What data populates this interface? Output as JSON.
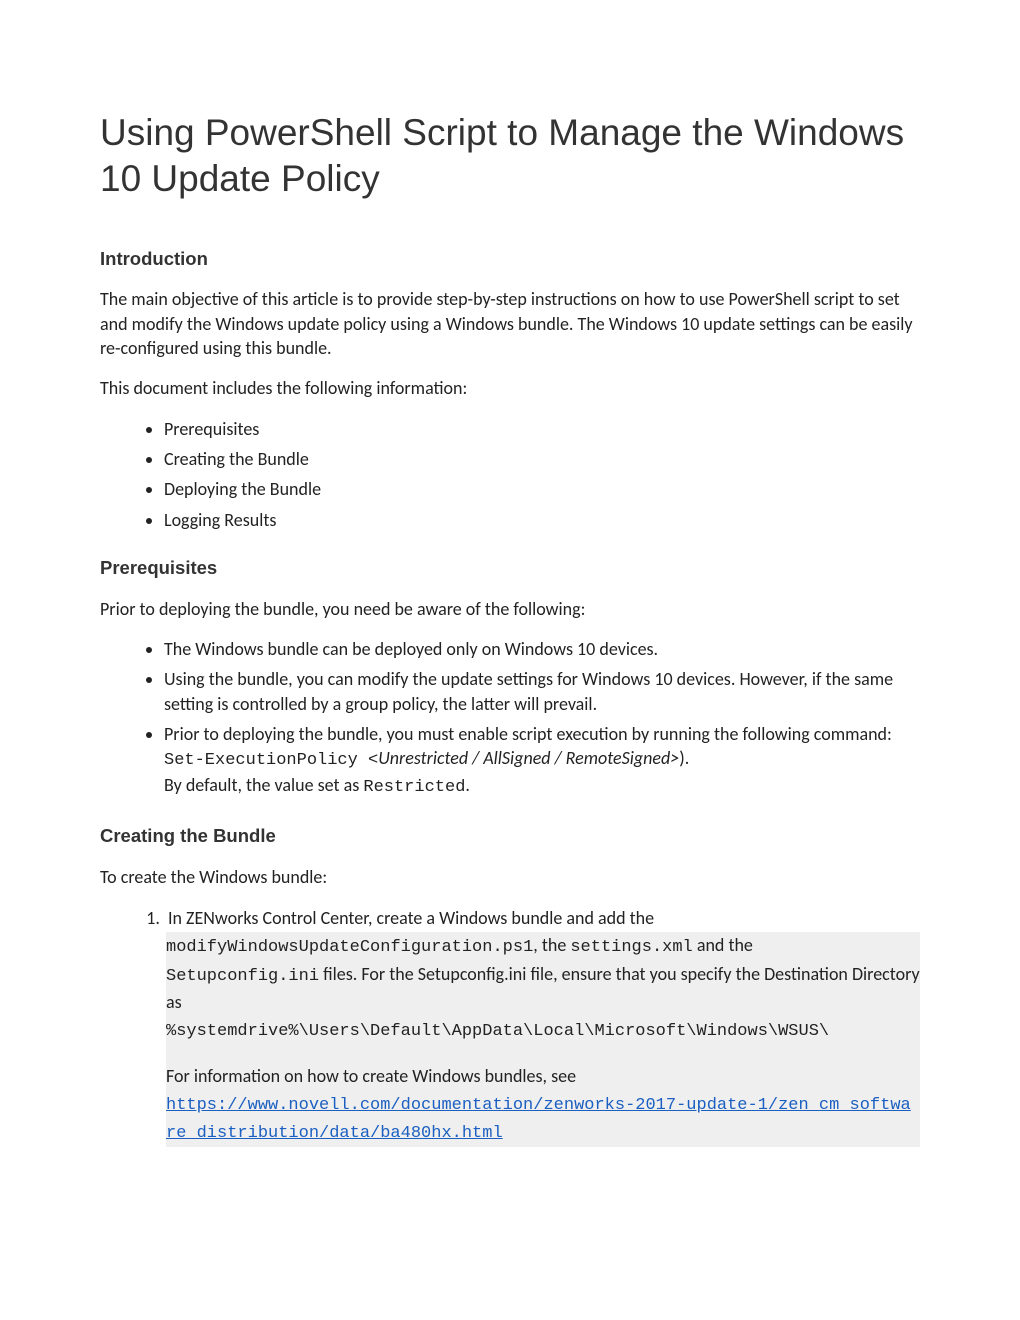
{
  "title": "Using PowerShell Script to Manage the Windows 10 Update Policy",
  "intro": {
    "heading": "Introduction",
    "p1": "The main objective of this article is to provide step-by-step instructions on how to use PowerShell script to set and modify the Windows update policy using a Windows bundle. The Windows 10 update settings can be easily re-configured using this bundle.",
    "p2": "This document includes the following information:",
    "bullets": [
      "Prerequisites",
      "Creating the Bundle",
      "Deploying the Bundle",
      "Logging Results"
    ]
  },
  "prereq": {
    "heading": "Prerequisites",
    "p1": "Prior to deploying the bundle, you need be aware of the following:",
    "b1": "The Windows bundle can be deployed only on Windows 10 devices.",
    "b2": "Using the bundle, you can modify the update settings for Windows 10 devices. However, if the same setting is controlled by a group policy, the latter will prevail.",
    "b3_a": "Prior to deploying the bundle, you must enable script execution by running the following command: ",
    "b3_cmd": "Set-ExecutionPolicy <",
    "b3_italic": "Unrestricted / AllSigned / RemoteSigned>",
    "b3_close": ").",
    "b3_line2a": "By default, the value set as ",
    "b3_line2b": "Restricted",
    "b3_line2c": "."
  },
  "create": {
    "heading": "Creating the Bundle",
    "p1": "To create the Windows bundle:",
    "step1": {
      "a": "In ZENworks Control Center, create a Windows bundle and add the ",
      "file1_hl": "mod",
      "file1_rest": "ifyWindowsUpdateConfiguration.ps1",
      "b": ", the ",
      "file2": "settings.xml",
      "c": " and the ",
      "file3": "Setupconfig.ini",
      "d": " files. For the Setupconfig.ini file, ensure that you specify the Destination Directory as",
      "path": "%systemdrive%\\Users\\Default\\AppData\\Local\\Microsoft\\Windows\\WSUS\\",
      "info_a": "For information on how to create Windows bundles, see ",
      "link": "https://www.novell.com/documentation/zenworks-2017-update-1/zen_cm_software_distribution/data/ba480hx.html"
    }
  }
}
